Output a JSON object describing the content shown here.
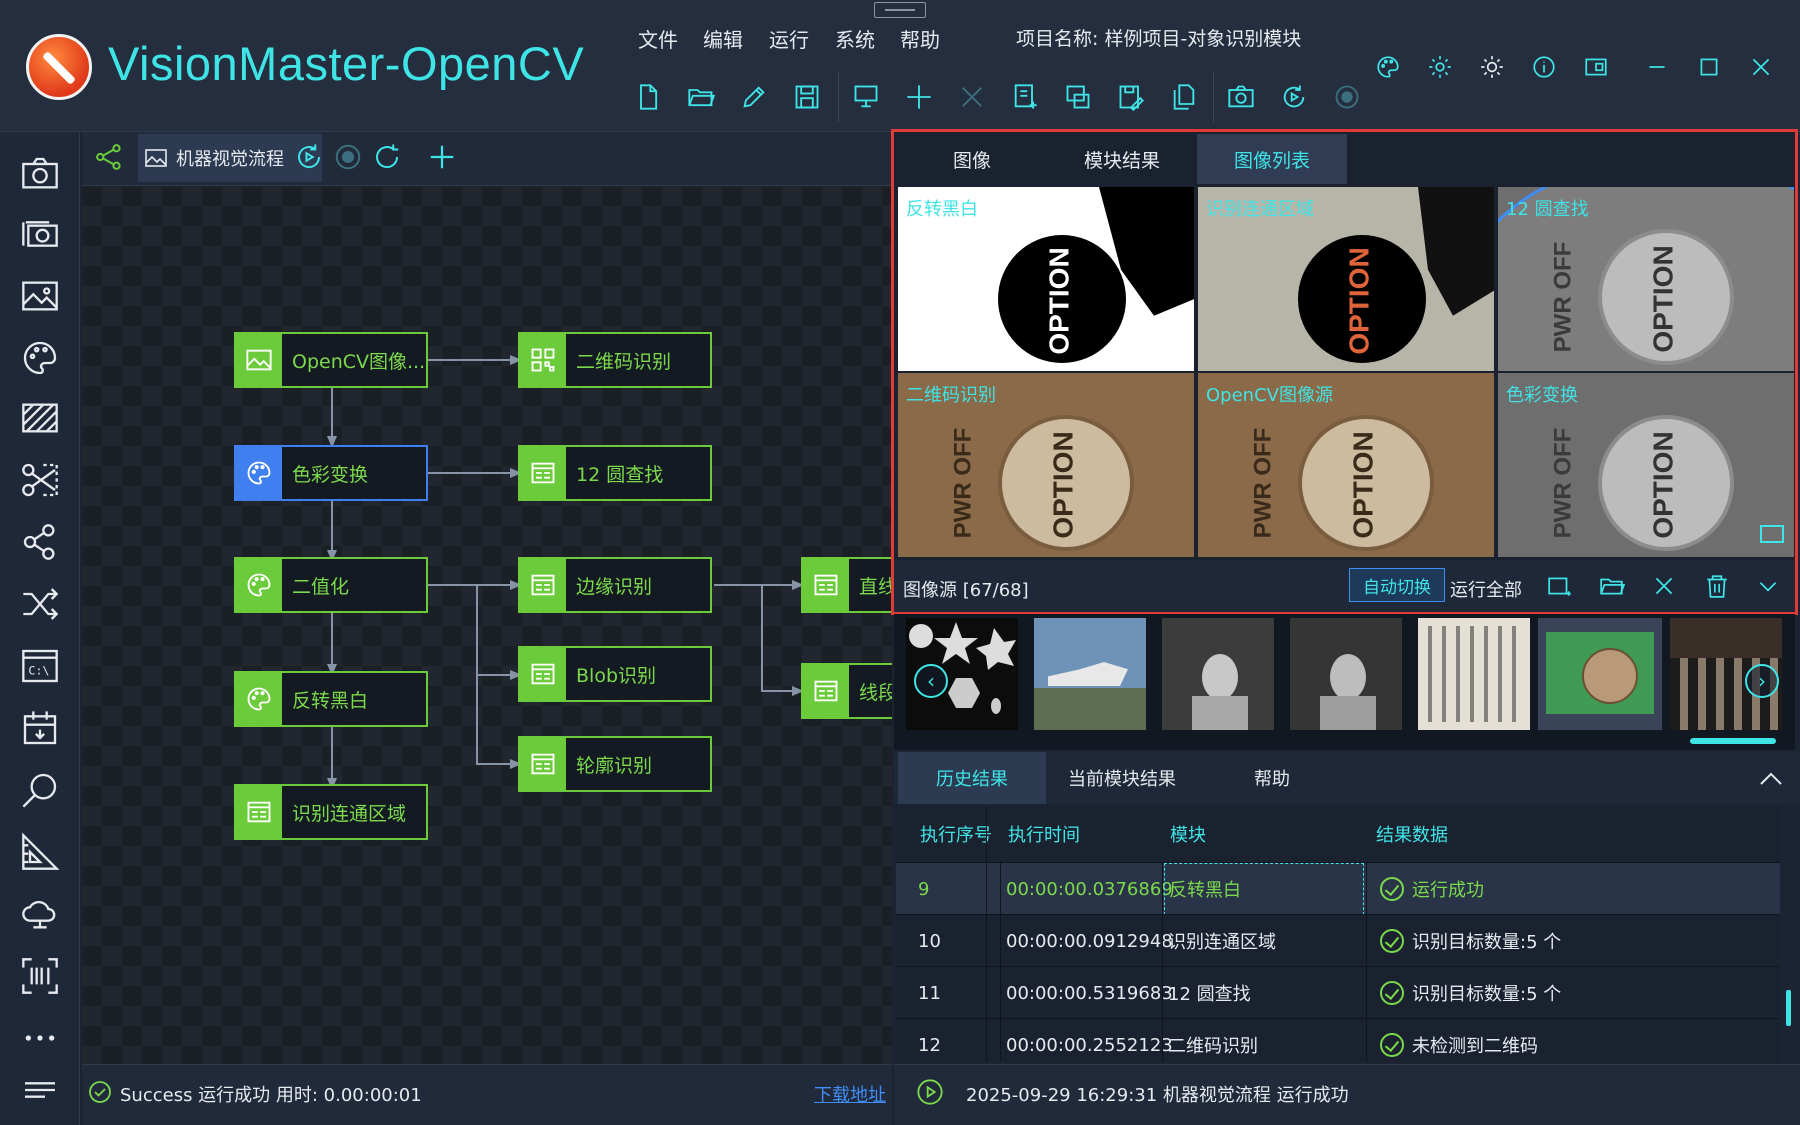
{
  "app": {
    "title": "VisionMaster-OpenCV"
  },
  "menu": [
    "文件",
    "编辑",
    "运行",
    "系统",
    "帮助"
  ],
  "project": {
    "label": "项目名称:  样例项目-对象识别模块"
  },
  "toolbar": {
    "icons": [
      "new-file-icon",
      "open-folder-icon",
      "edit-pencil-icon",
      "save-icon",
      "monitor-icon",
      "add-icon",
      "close-icon",
      "document-add-icon",
      "copy-window-icon",
      "save-edit-icon",
      "duplicate-icon",
      "camera-icon",
      "replay-icon",
      "record-icon"
    ]
  },
  "window_controls": [
    "palette-icon",
    "gear-icon",
    "brightness-icon",
    "info-icon",
    "monitor-icon",
    "minimize-icon",
    "maximize-icon",
    "close-icon"
  ],
  "sidebar": {
    "icons": [
      "camera-icon",
      "multi-camera-icon",
      "image-icon",
      "palette-icon",
      "texture-icon",
      "scissors-icon",
      "nodes-icon",
      "shuffle-icon",
      "terminal-icon",
      "calendar-icon",
      "search-icon",
      "measure-icon",
      "cloud-monitor-icon",
      "scan-icon",
      "more-icon",
      "menu-icon"
    ]
  },
  "flow": {
    "tab_label": "机器视觉流程",
    "nodes": [
      {
        "label": "OpenCV图像...",
        "icon": "image-icon"
      },
      {
        "label": "二维码识别",
        "icon": "qr-icon"
      },
      {
        "label": "色彩变换",
        "icon": "palette-icon"
      },
      {
        "label": "12 圆查找",
        "icon": "module-icon"
      },
      {
        "label": "二值化",
        "icon": "palette-icon"
      },
      {
        "label": "边缘识别",
        "icon": "module-icon"
      },
      {
        "label": "直线",
        "icon": "module-icon"
      },
      {
        "label": "Blob识别",
        "icon": "module-icon"
      },
      {
        "label": "线段",
        "icon": "module-icon"
      },
      {
        "label": "反转黑白",
        "icon": "palette-icon"
      },
      {
        "label": "轮廓识别",
        "icon": "module-icon"
      },
      {
        "label": "识别连通区域",
        "icon": "module-icon"
      }
    ]
  },
  "status_left": {
    "text": "Success 运行成功 用时: 0.00:00:01",
    "link": "下载地址"
  },
  "image_panel": {
    "tabs": [
      "图像",
      "模块结果",
      "图像列表"
    ],
    "active_tab": "图像列表",
    "thumbs": [
      "反转黑白",
      "识别连通区域",
      "12 圆查找",
      "二维码识别",
      "OpenCV图像源",
      "色彩变换"
    ],
    "button_text": "OPTION",
    "side_text": "PWR OFF",
    "source_label": "图像源 [67/68]",
    "auto_switch": "自动切换",
    "run_all": "运行全部"
  },
  "results": {
    "tabs": [
      "历史结果",
      "当前模块结果",
      "帮助"
    ],
    "columns": [
      "执行序号",
      "执行时间",
      "模块",
      "结果数据"
    ],
    "rows": [
      {
        "seq": "9",
        "time": "00:00:00.0376869",
        "module": "反转黑白",
        "result": "运行成功"
      },
      {
        "seq": "10",
        "time": "00:00:00.0912948",
        "module": "识别连通区域",
        "result": "识别目标数量:5 个"
      },
      {
        "seq": "11",
        "time": "00:00:00.5319683",
        "module": "12 圆查找",
        "result": "识别目标数量:5 个"
      },
      {
        "seq": "12",
        "time": "00:00:00.2552123",
        "module": "二维码识别",
        "result": "未检测到二维码"
      }
    ]
  },
  "status_right": {
    "text": "2025-09-29 16:29:31  机器视觉流程 运行成功"
  },
  "colors": {
    "accent": "#3fe4e6",
    "node_green": "#6ccb3a",
    "selected_blue": "#3f7ff0",
    "highlight_red": "#e23b35"
  }
}
